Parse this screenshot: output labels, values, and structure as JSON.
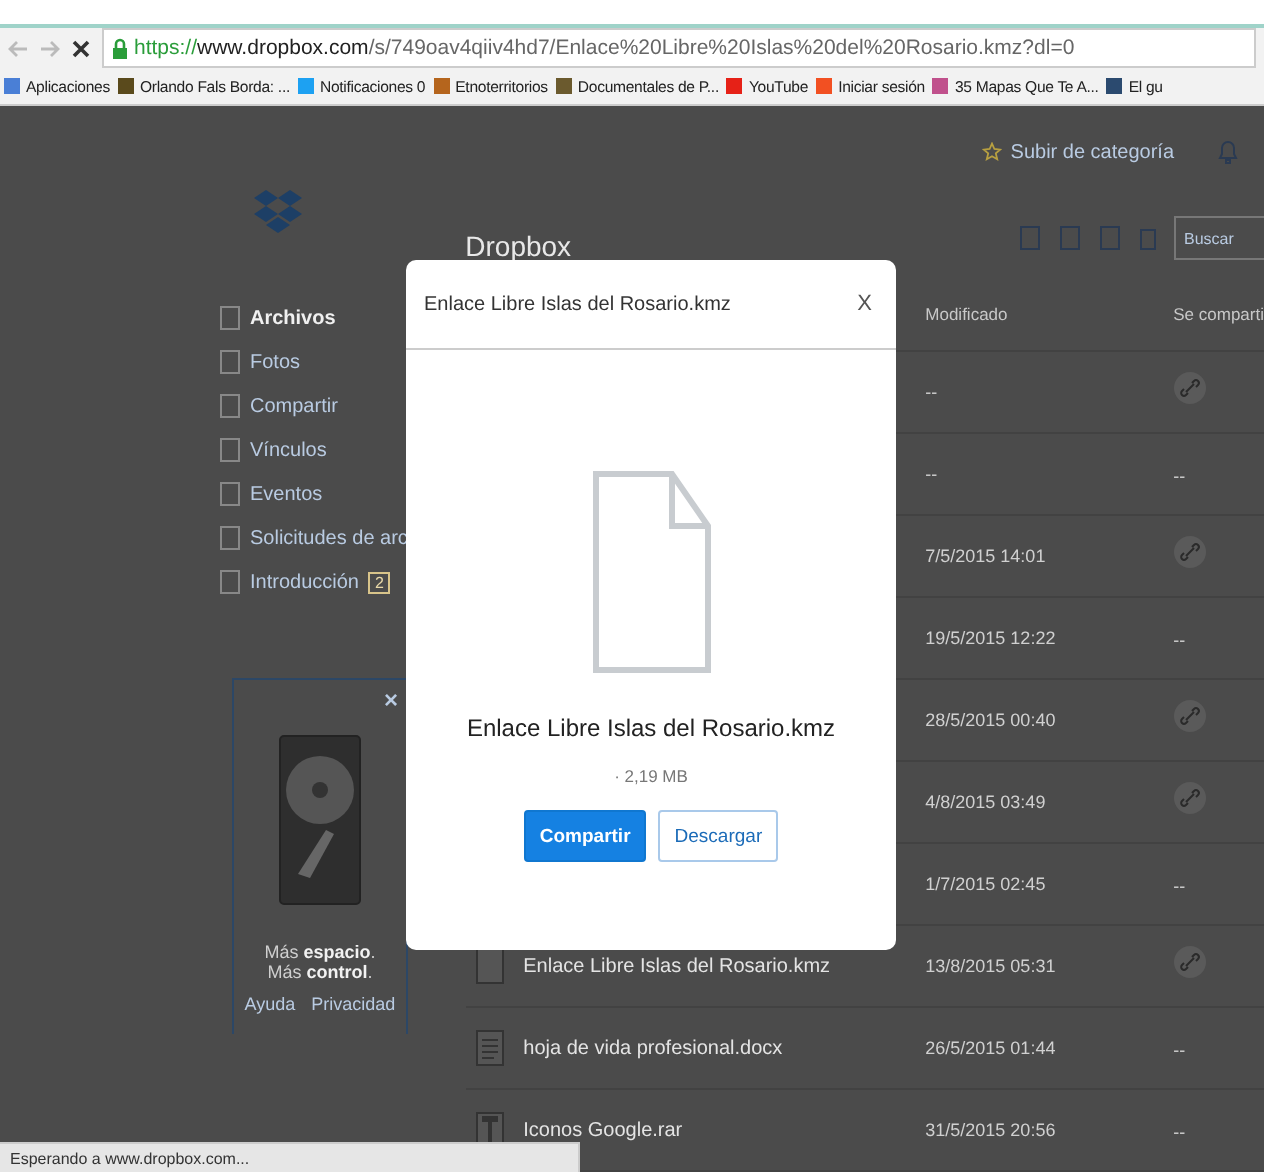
{
  "browser": {
    "url_scheme": "https://",
    "url_host": "www.dropbox.com",
    "url_path": "/s/749oav4qiiv4hd7/Enlace%20Libre%20Islas%20del%20Rosario.kmz?dl=0",
    "bookmarks": [
      {
        "label": "Aplicaciones",
        "color": "#4a7fd6"
      },
      {
        "label": "Orlando Fals Borda: ...",
        "color": "#5a4a1c"
      },
      {
        "label": "Notificaciones 0",
        "color": "#1da1f2"
      },
      {
        "label": "Etnoterritorios",
        "color": "#b5651d"
      },
      {
        "label": "Documentales de P...",
        "color": "#6b5a2e"
      },
      {
        "label": "YouTube",
        "color": "#e62117"
      },
      {
        "label": "Iniciar sesión",
        "color": "#f25022"
      },
      {
        "label": "35 Mapas Que Te A...",
        "color": "#c0508c"
      },
      {
        "label": "El gu",
        "color": "#2b4a6f"
      }
    ],
    "loading_status": "Esperando a www.dropbox.com..."
  },
  "header": {
    "upgrade_link": "Subir de categoría",
    "title": "Dropbox",
    "search": {
      "placeholder": "Buscar"
    }
  },
  "sidebar": {
    "nav": [
      {
        "label": "Archivos",
        "selected": true
      },
      {
        "label": "Fotos",
        "selected": false
      },
      {
        "label": "Compartir",
        "selected": false
      },
      {
        "label": "Vínculos",
        "selected": false
      },
      {
        "label": "Eventos",
        "selected": false
      },
      {
        "label": "Solicitudes de arc",
        "selected": false
      },
      {
        "label": "Introducción",
        "badge": "2",
        "selected": false
      }
    ]
  },
  "upgrade_card": {
    "close": "×",
    "lines": [
      "Más **espacio**.",
      "Más **control**."
    ],
    "links": [
      "Ayuda",
      "Privacidad"
    ]
  },
  "table": {
    "columns": [
      "Modificado",
      "Se comparti"
    ],
    "rows": [
      {
        "modified": "--",
        "shared_link": true
      },
      {
        "modified": "--",
        "shared_link": false,
        "shared": "--"
      },
      {
        "modified": "7/5/2015 14:01",
        "shared_link": true
      },
      {
        "modified": "19/5/2015 12:22",
        "shared_link": false,
        "shared": "--"
      },
      {
        "modified": "28/5/2015 00:40",
        "shared_link": true
      },
      {
        "modified": "4/8/2015 03:49",
        "shared_link": true
      },
      {
        "modified": "1/7/2015 02:45",
        "shared_link": false,
        "shared": "--"
      },
      {
        "name": "Enlace Libre Islas del Rosario.kmz",
        "kind": "generic",
        "modified": "13/8/2015 05:31",
        "shared_link": true
      },
      {
        "name": "hoja de vida profesional.docx",
        "kind": "document",
        "modified": "26/5/2015 01:44",
        "shared_link": false,
        "shared": "--"
      },
      {
        "name": "Iconos Google.rar",
        "kind": "archive",
        "modified": "31/5/2015 20:56",
        "shared_link": false,
        "shared": "--"
      }
    ]
  },
  "modal": {
    "title": "Enlace Libre Islas del Rosario.kmz",
    "close": "X",
    "file_name": "Enlace Libre Islas del Rosario.kmz",
    "size": "· 2,19 MB",
    "buttons": [
      {
        "label": "Compartir",
        "kind": "primary"
      },
      {
        "label": "Descargar",
        "kind": "secondary"
      }
    ]
  }
}
